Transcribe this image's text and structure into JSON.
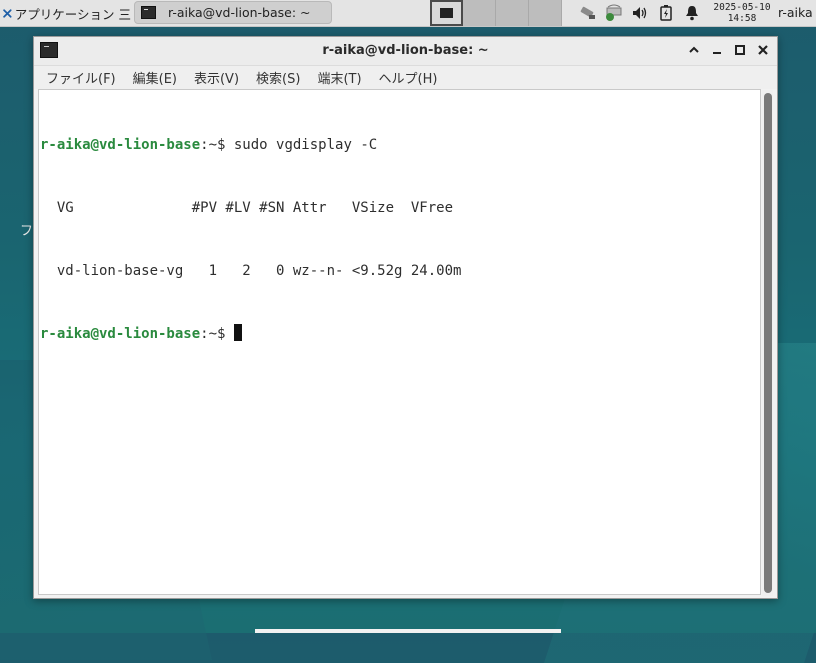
{
  "panel": {
    "apps_label": "アプリケーション",
    "task_label": "r-aika@vd-lion-base: ~",
    "clock_date": "2025-05-10",
    "clock_time": "14:58",
    "user": "r-aika"
  },
  "desktop": {
    "partial_label": "フ"
  },
  "window": {
    "title": "r-aika@vd-lion-base: ~",
    "menu": [
      "ファイル(F)",
      "編集(E)",
      "表示(V)",
      "検索(S)",
      "端末(T)",
      "ヘルプ(H)"
    ]
  },
  "terminal": {
    "prompt_user_host": "r-aika@vd-lion-base",
    "prompt_suffix": ":~$",
    "command": " sudo vgdisplay -C",
    "header_line": "  VG              #PV #LV #SN Attr   VSize  VFree ",
    "row_line": "  vd-lion-base-vg   1   2   0 wz--n- <9.52g 24.00m"
  },
  "colors": {
    "prompt": "#2a8a3e",
    "desktop": "#1a6570"
  }
}
